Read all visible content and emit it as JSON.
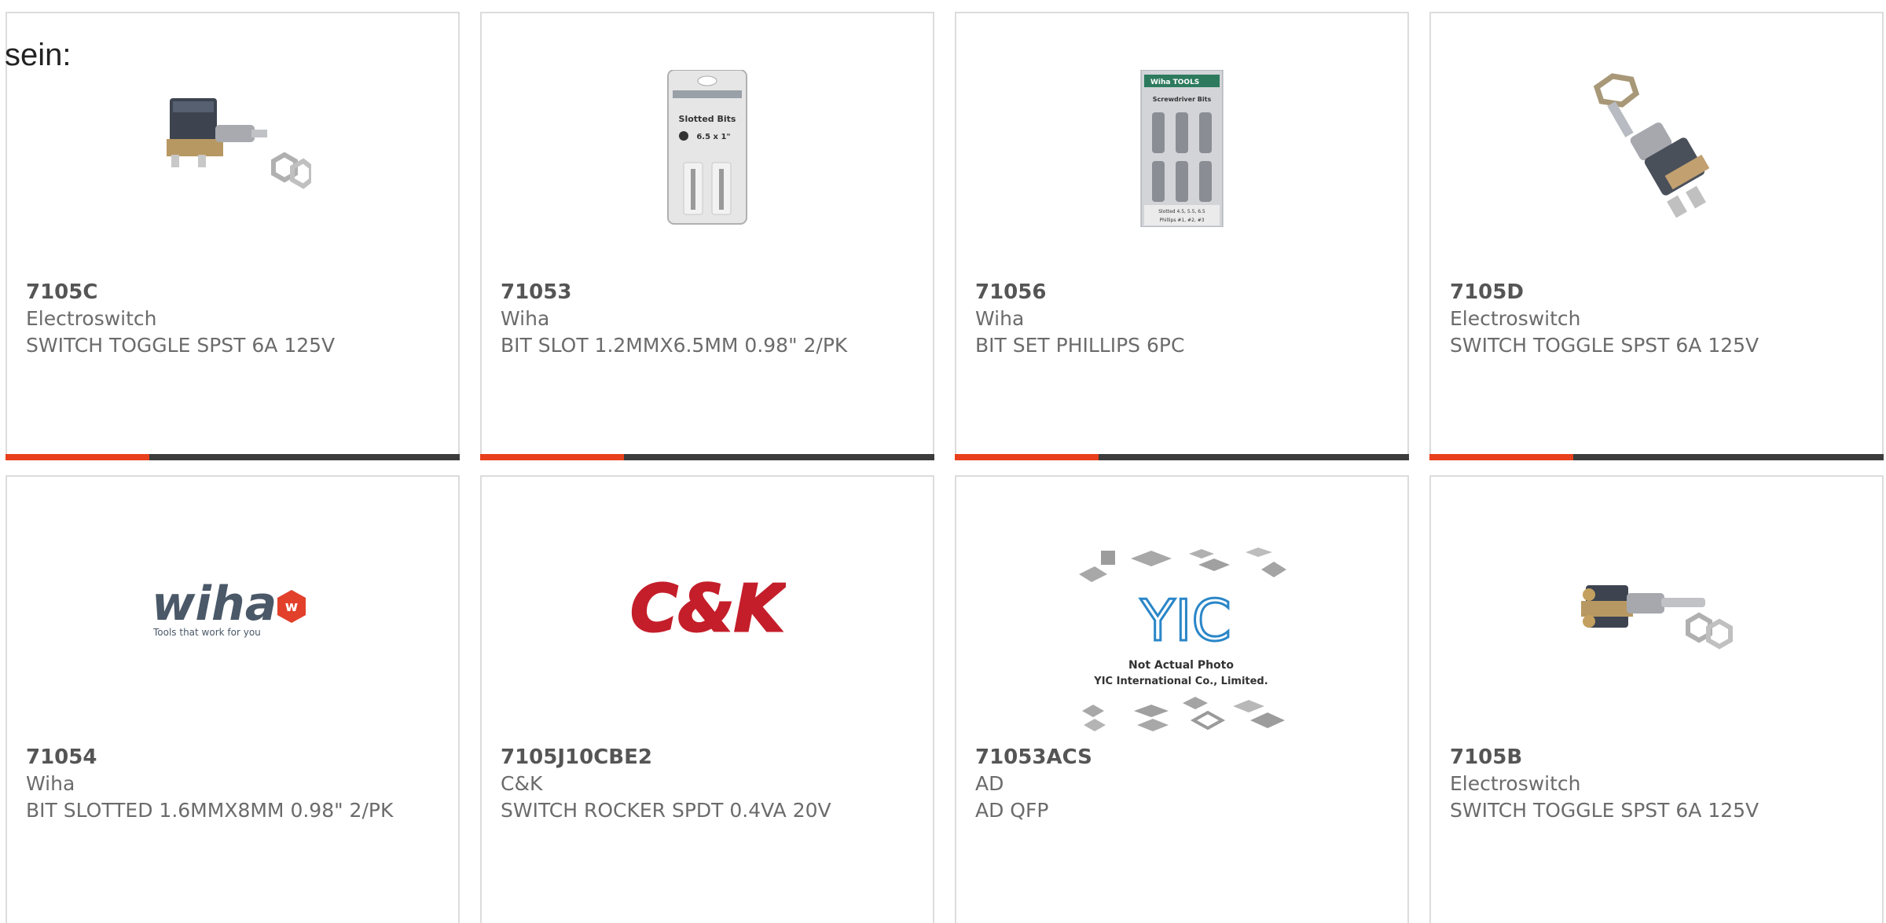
{
  "fragment_text": "sein:",
  "colors": {
    "accent": "#e8401c",
    "bar": "#3c3c3c",
    "border": "#dcdcdc"
  },
  "products": [
    {
      "part": "7105C",
      "maker": "Electroswitch",
      "desc": "SWITCH TOGGLE SPST 6A 125V",
      "image": "toggle-switch-photo"
    },
    {
      "part": "71053",
      "maker": "Wiha",
      "desc": "BIT SLOT 1.2MMX6.5MM 0.98\" 2/PK",
      "image": "slotted-bits-pack-photo",
      "image_text": [
        "Slotted Bits",
        "6.5 x 1\""
      ]
    },
    {
      "part": "71056",
      "maker": "Wiha",
      "desc": "BIT SET PHILLIPS 6PC",
      "image": "screwdriver-bits-pack-photo",
      "image_text": [
        "Wiha TOOLS",
        "Screwdriver Bits",
        "Slotted 4.5, 5.5, 6.5",
        "Phillips #1, #2, #3"
      ]
    },
    {
      "part": "7105D",
      "maker": "Electroswitch",
      "desc": "SWITCH TOGGLE SPST 6A 125V",
      "image": "toggle-switch-photo"
    },
    {
      "part": "71054",
      "maker": "Wiha",
      "desc": "BIT SLOTTED 1.6MMX8MM 0.98\" 2/PK",
      "image": "wiha-logo",
      "image_text": [
        "wiha",
        "Tools that work for you"
      ]
    },
    {
      "part": "7105J10CBE2",
      "maker": "C&K",
      "desc": "SWITCH ROCKER SPDT 0.4VA 20V",
      "image": "ck-logo",
      "image_text": [
        "C&K"
      ]
    },
    {
      "part": "71053ACS",
      "maker": "AD",
      "desc": "AD QFP",
      "image": "yic-placeholder",
      "image_text": [
        "YIC",
        "Not Actual Photo",
        "YIC International Co., Limited."
      ]
    },
    {
      "part": "7105B",
      "maker": "Electroswitch",
      "desc": "SWITCH TOGGLE SPST 6A 125V",
      "image": "toggle-switch-photo"
    }
  ]
}
